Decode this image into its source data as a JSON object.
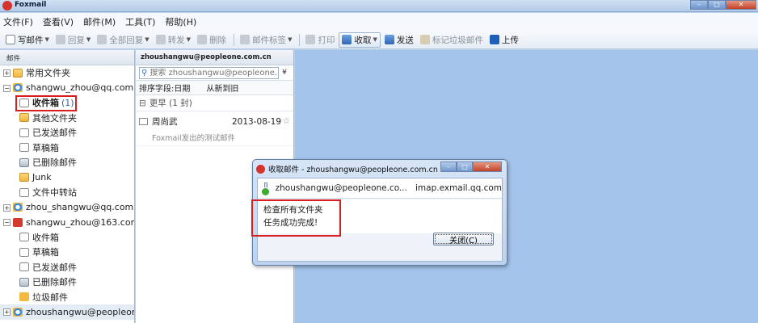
{
  "titlebar": {
    "title": "Foxmail"
  },
  "menu": [
    "文件(F)",
    "查看(V)",
    "邮件(M)",
    "工具(T)",
    "帮助(H)"
  ],
  "toolbar": {
    "compose": "写邮件",
    "reply": "回复",
    "reply_all": "全部回复",
    "forward": "转发",
    "delete": "删除",
    "tag": "邮件标签",
    "print": "打印",
    "receive": "收取",
    "send": "发送",
    "mark_spam": "标记垃圾邮件",
    "upload": "上传"
  },
  "left_pane": {
    "header": "邮件",
    "common_folders": "常用文件夹",
    "account1": {
      "name": "shangwu_zhou@qq.com",
      "inbox": "收件箱",
      "inbox_count": "(1)",
      "other": "其他文件夹",
      "sent": "已发送邮件",
      "drafts": "草稿箱",
      "deleted": "已删除邮件",
      "junk": "Junk",
      "transit": "文件中转站"
    },
    "account2": {
      "name": "zhou_shangwu@qq.com"
    },
    "account3": {
      "name": "shangwu_zhou@163.com",
      "inbox": "收件箱",
      "drafts": "草稿箱",
      "sent": "已发送邮件",
      "deleted": "已删除邮件",
      "spam": "垃圾邮件"
    },
    "account4": {
      "name": "zhoushangwu@peopleone.com"
    }
  },
  "mid_pane": {
    "header": "zhoushangwu@peopleone.com.cn",
    "search_placeholder": "搜索 zhoushangwu@peopleone.",
    "sort_field": "排序字段:日期",
    "sort_order": "从新到旧",
    "group": "更早 (1 封)",
    "mail": {
      "sender": "周尚武",
      "date": "2013-08-19",
      "preview": "Foxmail发出的测试邮件"
    }
  },
  "dialog": {
    "title": "收取邮件 - zhoushangwu@peopleone.com.cn",
    "account": "zhoushangwu@peopleone.co...",
    "server": "imap.exmail.qq.com",
    "message_line1": "检查所有文件夹",
    "message_line2": "任务成功完成!",
    "close_button": "关闭(C)"
  },
  "colors": {
    "highlight_box": "#d81e1e",
    "right_pane_bg": "#a4c4ec",
    "titlebar": "#b3cbe8"
  }
}
